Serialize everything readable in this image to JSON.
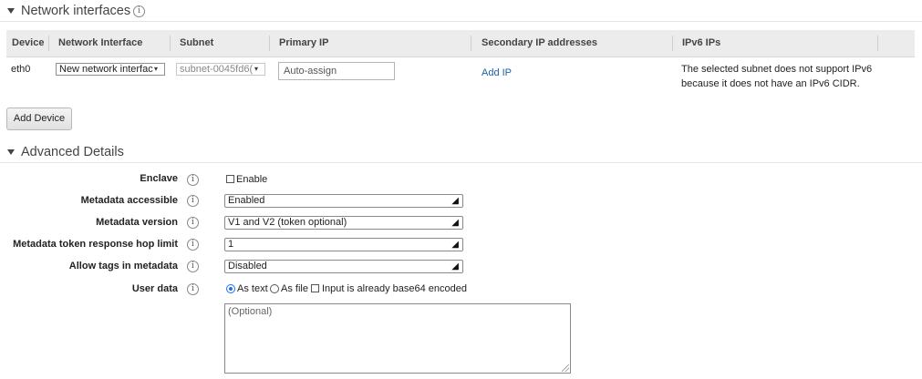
{
  "network_section": {
    "title": "Network interfaces",
    "table": {
      "headers": [
        "Device",
        "Network Interface",
        "Subnet",
        "Primary IP",
        "Secondary IP addresses",
        "IPv6 IPs"
      ],
      "row": {
        "device": "eth0",
        "network_interface": "New network interfac",
        "subnet": "subnet-0045fd6(",
        "primary_ip_placeholder": "Auto-assign",
        "secondary_ip_link": "Add IP",
        "ipv6_message_line1": "The selected subnet does not support IPv6",
        "ipv6_message_line2": "because it does not have an IPv6 CIDR."
      }
    },
    "add_device_label": "Add Device"
  },
  "advanced_section": {
    "title": "Advanced Details",
    "enclave": {
      "label": "Enclave",
      "option_label": "Enable",
      "checked": false
    },
    "metadata_accessible": {
      "label": "Metadata accessible",
      "value": "Enabled"
    },
    "metadata_version": {
      "label": "Metadata version",
      "value": "V1 and V2 (token optional)"
    },
    "hop_limit": {
      "label": "Metadata token response hop limit",
      "value": "1"
    },
    "allow_tags": {
      "label": "Allow tags in metadata",
      "value": "Disabled"
    },
    "user_data": {
      "label": "User data",
      "as_text_label": "As text",
      "as_file_label": "As file",
      "base64_label": "Input is already base64 encoded",
      "selected": "As text",
      "base64_checked": false,
      "textarea_placeholder": "(Optional)"
    }
  },
  "icons": {
    "info": "i",
    "dropdown_arrow": "◢",
    "small_dropdown_arrow": "▾"
  },
  "colors": {
    "link": "#1a5fa8",
    "header_bg": "#ececec",
    "radio_selected": "#1a73e8"
  }
}
